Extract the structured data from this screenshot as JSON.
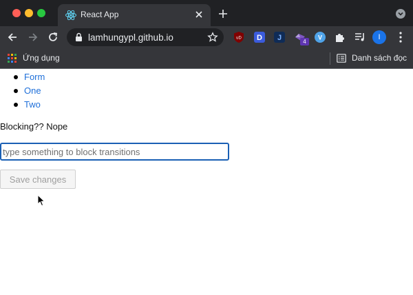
{
  "browser": {
    "tab": {
      "title": "React App",
      "favicon": "react-atom-icon"
    },
    "address_bar": {
      "url": "lamhungypl.github.io"
    },
    "extensions": [
      {
        "name": "ublock-icon",
        "label": "uD"
      },
      {
        "name": "d-extension-icon",
        "label": "D"
      },
      {
        "name": "j-extension-icon",
        "label": "J"
      },
      {
        "name": "purple-extension-icon",
        "badge": "4"
      },
      {
        "name": "v-extension-icon",
        "label": "V"
      }
    ],
    "profile": {
      "initial": "I"
    },
    "bookmarks": {
      "apps_label": "Ứng dụng",
      "reading_list_label": "Danh sách đọc"
    },
    "colors": {
      "frame": "#202124",
      "toolbar": "#35363a",
      "text": "#e8eaed",
      "accent": "#1a73e8"
    }
  },
  "page": {
    "nav_links": [
      "Form",
      "One",
      "Two"
    ],
    "blocking_text": "Blocking?? Nope",
    "input": {
      "placeholder": "type something to block transitions",
      "value": ""
    },
    "save_button": {
      "label": "Save changes",
      "disabled": true
    }
  }
}
